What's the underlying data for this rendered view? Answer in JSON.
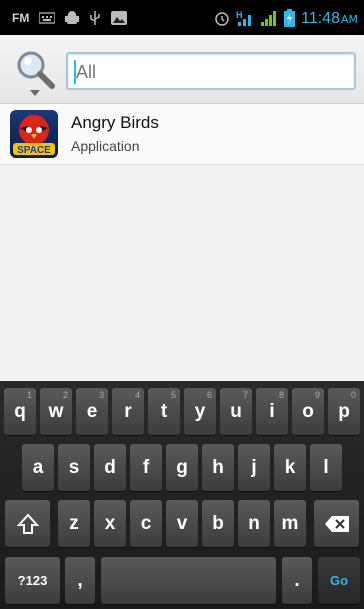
{
  "status_bar": {
    "fm_label": "FM",
    "time": "11:48",
    "ampm": "AM",
    "accent_color": "#33b5e5"
  },
  "search": {
    "value": "All",
    "placeholder": "All"
  },
  "results": [
    {
      "title": "Angry Birds",
      "subtitle": "Application",
      "icon": "angry-birds-space-icon"
    }
  ],
  "keyboard": {
    "row1": [
      {
        "label": "q",
        "hint": "1"
      },
      {
        "label": "w",
        "hint": "2"
      },
      {
        "label": "e",
        "hint": "3"
      },
      {
        "label": "r",
        "hint": "4"
      },
      {
        "label": "t",
        "hint": "5"
      },
      {
        "label": "y",
        "hint": "6"
      },
      {
        "label": "u",
        "hint": "7"
      },
      {
        "label": "i",
        "hint": "8"
      },
      {
        "label": "o",
        "hint": "9"
      },
      {
        "label": "p",
        "hint": "0"
      }
    ],
    "row2": [
      "a",
      "s",
      "d",
      "f",
      "g",
      "h",
      "j",
      "k",
      "l"
    ],
    "row3": [
      "z",
      "x",
      "c",
      "v",
      "b",
      "n",
      "m"
    ],
    "symbols_label": "?123",
    "comma_label": ",",
    "period_label": ".",
    "go_label": "Go"
  }
}
